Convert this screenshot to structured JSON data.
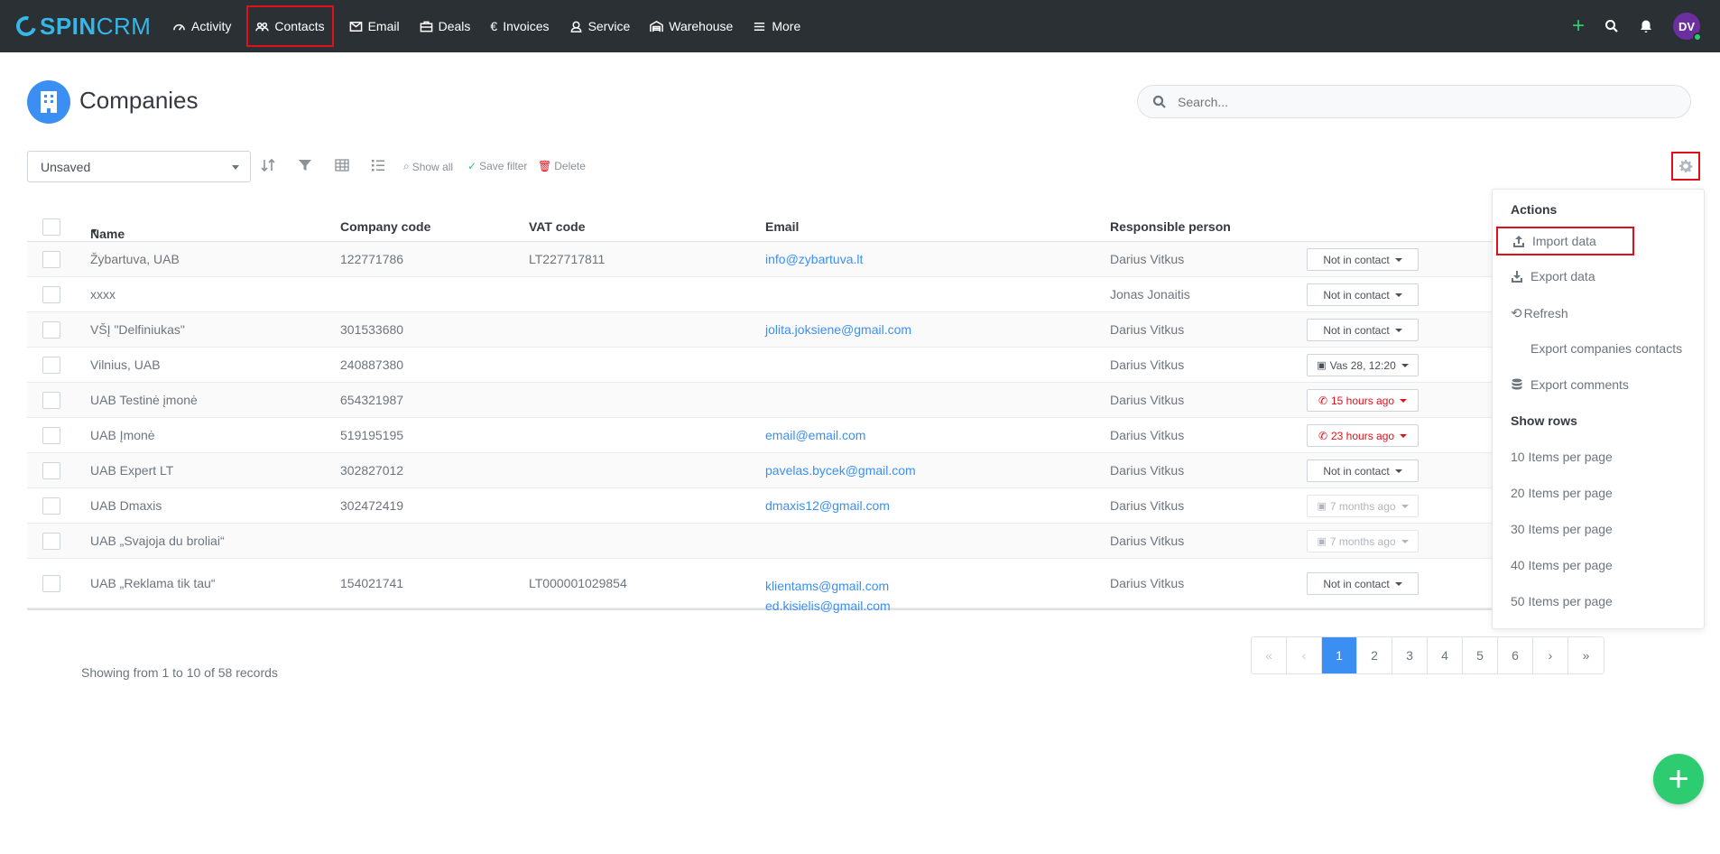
{
  "app": {
    "brand_a": "SPIN",
    "brand_b": "CRM"
  },
  "nav": [
    {
      "label": "Activity",
      "icon": "gauge-icon"
    },
    {
      "label": "Contacts",
      "icon": "users-icon"
    },
    {
      "label": "Email",
      "icon": "envelope-icon"
    },
    {
      "label": "Deals",
      "icon": "briefcase-icon"
    },
    {
      "label": "Invoices",
      "icon": "euro-icon"
    },
    {
      "label": "Service",
      "icon": "support-icon"
    },
    {
      "label": "Warehouse",
      "icon": "warehouse-icon"
    },
    {
      "label": "More",
      "icon": "menu-icon"
    }
  ],
  "user": {
    "initials": "DV"
  },
  "page": {
    "title": "Companies",
    "search_placeholder": "Search..."
  },
  "toolbar": {
    "filter_value": "Unsaved",
    "show_all": "Show all",
    "save_filter": "Save filter",
    "delete": "Delete"
  },
  "table": {
    "headers": {
      "name": "Name",
      "code": "Company code",
      "vat": "VAT code",
      "email": "Email",
      "person": "Responsible person"
    },
    "rows": [
      {
        "name": "Žybartuva, UAB",
        "code": "122771786",
        "vat": "LT227717811",
        "email": "info@zybartuva.lt",
        "email2": "",
        "person": "Darius Vitkus",
        "status": "Not in contact",
        "status_type": "normal"
      },
      {
        "name": "xxxx",
        "code": "",
        "vat": "",
        "email": "",
        "email2": "",
        "person": "Jonas Jonaitis",
        "status": "Not in contact",
        "status_type": "normal"
      },
      {
        "name": "VŠĮ \"Delfiniukas\"",
        "code": "301533680",
        "vat": "",
        "email": "jolita.joksiene@gmail.com",
        "email2": "",
        "person": "Darius Vitkus",
        "status": "Not in contact",
        "status_type": "normal"
      },
      {
        "name": "Vilnius, UAB",
        "code": "240887380",
        "vat": "",
        "email": "",
        "email2": "",
        "person": "Darius Vitkus",
        "status": "Vas 28, 12:20",
        "status_type": "calendar"
      },
      {
        "name": "UAB Testinė įmonė",
        "code": "654321987",
        "vat": "",
        "email": "",
        "email2": "",
        "person": "Darius Vitkus",
        "status": "15 hours ago",
        "status_type": "red"
      },
      {
        "name": "UAB Įmonė",
        "code": "519195195",
        "vat": "",
        "email": "email@email.com",
        "email2": "",
        "person": "Darius Vitkus",
        "status": "23 hours ago",
        "status_type": "red"
      },
      {
        "name": "UAB Expert LT",
        "code": "302827012",
        "vat": "",
        "email": "pavelas.bycek@gmail.com",
        "email2": "",
        "person": "Darius Vitkus",
        "status": "Not in contact",
        "status_type": "normal"
      },
      {
        "name": "UAB Dmaxis",
        "code": "302472419",
        "vat": "",
        "email": "dmaxis12@gmail.com",
        "email2": "",
        "person": "Darius Vitkus",
        "status": "7 months ago",
        "status_type": "muted"
      },
      {
        "name": "UAB „Svajoja du broliai“",
        "code": "",
        "vat": "",
        "email": "",
        "email2": "",
        "person": "Darius Vitkus",
        "status": "7 months ago",
        "status_type": "muted"
      },
      {
        "name": "UAB „Reklama tik tau“",
        "code": "154021741",
        "vat": "LT000001029854",
        "email": "klientams@gmail.com",
        "email2": "ed.kisielis@gmail.com",
        "person": "Darius Vitkus",
        "status": "Not in contact",
        "status_type": "normal"
      }
    ]
  },
  "footer": {
    "showing": "Showing from 1 to 10 of 58 records",
    "pages": [
      "1",
      "2",
      "3",
      "4",
      "5",
      "6"
    ],
    "current_page": "1"
  },
  "menu": {
    "actions_header": "Actions",
    "import": "Import data",
    "export": "Export data",
    "refresh": "Refresh",
    "export_contacts": "Export companies contacts",
    "export_comments": "Export comments",
    "rows_header": "Show rows",
    "rows_options": [
      "10 Items per page",
      "20 Items per page",
      "30 Items per page",
      "40 Items per page",
      "50 Items per page"
    ]
  },
  "colors": {
    "nav_bg": "#2b3035",
    "accent": "#3b8ff2",
    "success": "#2ecc71",
    "danger": "#e0101a"
  }
}
